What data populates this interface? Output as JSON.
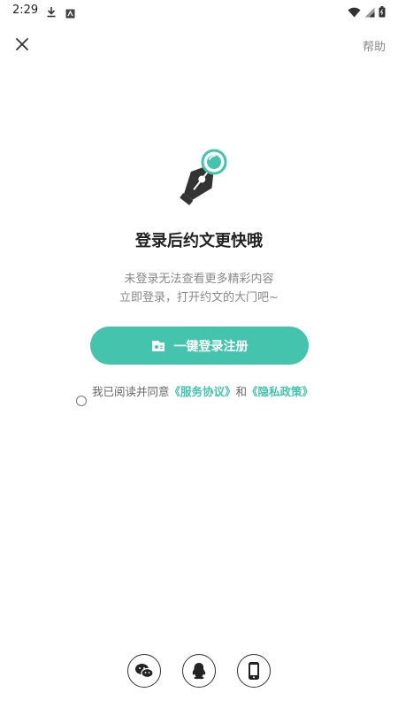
{
  "status_bar": {
    "time": "2:29"
  },
  "header": {
    "help_label": "帮助"
  },
  "main": {
    "title": "登录后约文更快哦",
    "subtitle_line1": "未登录无法查看更多精彩内容",
    "subtitle_line2": "立即登录，打开约文的大门吧~",
    "login_button_label": "一键登录注册"
  },
  "agreement": {
    "prefix": "我已阅读并同意",
    "service_link": "《服务协议》",
    "conjunction": "和",
    "privacy_link": "《隐私政策》",
    "checked": false
  },
  "social": {
    "icons": [
      "wechat-icon",
      "qq-icon",
      "phone-icon"
    ]
  },
  "colors": {
    "accent": "#44c4ad",
    "text_dark": "#222222",
    "text_gray": "#888888"
  }
}
